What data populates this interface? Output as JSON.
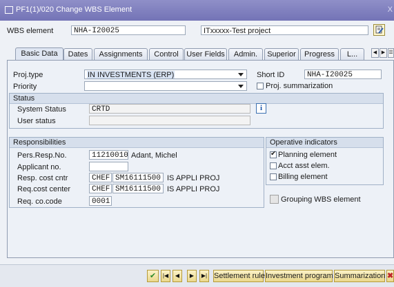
{
  "window": {
    "title": "PF1(1)/020 Change WBS Element",
    "close": "X"
  },
  "header": {
    "wbs_label": "WBS element",
    "wbs_value": "NHA-I20025",
    "wbs_desc": "ITxxxxx-Test project"
  },
  "tabs": [
    {
      "label": "Basic Data"
    },
    {
      "label": "Dates"
    },
    {
      "label": "Assignments"
    },
    {
      "label": "Control"
    },
    {
      "label": "User Fields"
    },
    {
      "label": "Admin."
    },
    {
      "label": "Superior"
    },
    {
      "label": "Progress"
    },
    {
      "label": "L..."
    }
  ],
  "basic": {
    "projtype_label": "Proj.type",
    "projtype_value": "IN INVESTMENTS (ERP)",
    "priority_label": "Priority",
    "priority_value": "",
    "shortid_label": "Short ID",
    "shortid_value": "NHA-I20025",
    "projsum_label": "Proj. summarization"
  },
  "status": {
    "title": "Status",
    "system_label": "System Status",
    "system_value": "CRTD",
    "user_label": "User status",
    "user_value": "",
    "info_icon": "i"
  },
  "resp": {
    "title": "Responsibilities",
    "pers_label": "Pers.Resp.No.",
    "pers_value": "11210010",
    "pers_name": "Adant, Michel",
    "applicant_label": "Applicant no.",
    "applicant_value": "",
    "resp_cc_label": "Resp. cost cntr",
    "resp_cc_1": "CHEF",
    "resp_cc_2": "SM16111500",
    "resp_cc_desc": "IS APPLI PROJ",
    "req_cc_label": "Req.cost center",
    "req_cc_1": "CHEF",
    "req_cc_2": "SM16111500",
    "req_cc_desc": "IS APPLI PROJ",
    "req_code_label": "Req. co.code",
    "req_code_value": "0001"
  },
  "operative": {
    "title": "Operative indicators",
    "planning": {
      "label": "Planning element",
      "checked": true
    },
    "acct": {
      "label": "Acct asst elem.",
      "checked": false
    },
    "billing": {
      "label": "Billing element",
      "checked": false
    }
  },
  "grouping": {
    "label": "Grouping WBS element",
    "checked": false
  },
  "toolbar": {
    "settlement": "Settlement rule",
    "investment": "Investment program",
    "summarization": "Summarization"
  }
}
